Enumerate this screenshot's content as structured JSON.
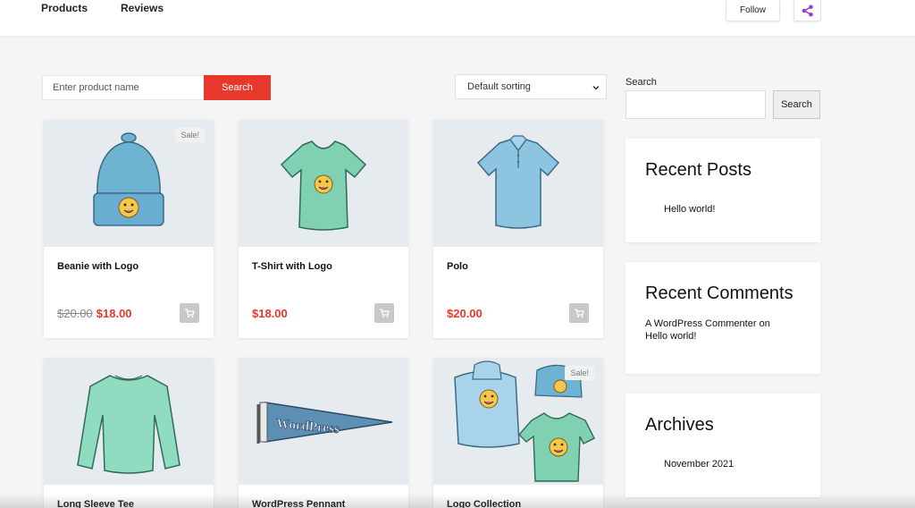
{
  "header": {
    "nav": [
      {
        "label": "Products"
      },
      {
        "label": "Reviews"
      }
    ],
    "follow_label": "Follow"
  },
  "shop": {
    "search_placeholder": "Enter product name",
    "search_button": "Search",
    "sorting": "Default sorting"
  },
  "products": [
    {
      "name": "Beanie with Logo",
      "old_price": "$20.00",
      "price": "$18.00",
      "sale": "Sale!",
      "image": "beanie"
    },
    {
      "name": "T-Shirt with Logo",
      "price": "$18.00",
      "image": "tshirt"
    },
    {
      "name": "Polo",
      "price": "$20.00",
      "image": "polo"
    },
    {
      "name": "Long Sleeve Tee",
      "image": "long-sleeve-tee"
    },
    {
      "name": "WordPress Pennant",
      "image": "pennant",
      "pennant_text": "WordPress"
    },
    {
      "name": "Logo Collection",
      "sale": "Sale!",
      "image": "logo-collection"
    }
  ],
  "sidebar": {
    "search_label": "Search",
    "search_button": "Search",
    "recent_posts": {
      "title": "Recent Posts",
      "items": [
        "Hello world!"
      ]
    },
    "recent_comments": {
      "title": "Recent Comments",
      "author": "A WordPress Commenter",
      "on": "on",
      "post": "Hello world!"
    },
    "archives": {
      "title": "Archives",
      "items": [
        "November 2021"
      ]
    }
  },
  "colors": {
    "accent": "#e8382b",
    "share_icon": "#9b3fc4",
    "product_image_bg": "#e6ebf0",
    "beanie": "#6fb3d3",
    "shirt_green": "#7fd1b2",
    "polo_blue": "#8dc4e0",
    "face_yellow": "#f5c84c"
  }
}
